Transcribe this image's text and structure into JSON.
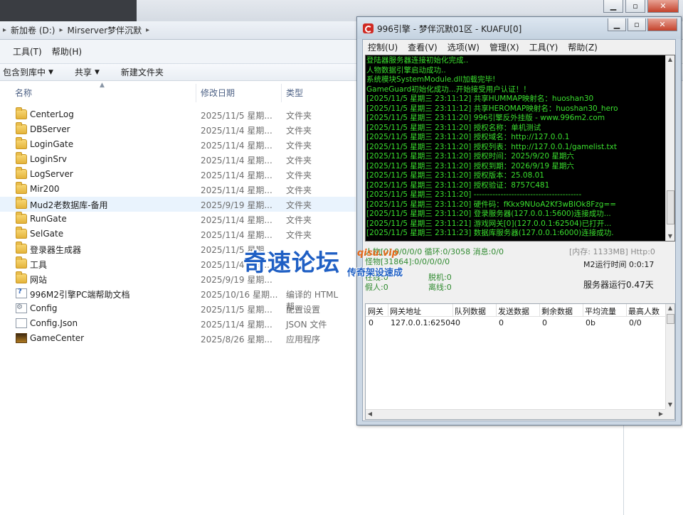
{
  "explorer": {
    "breadcrumb": [
      "新加卷 (D:)",
      "Mirserver梦伴沉默"
    ],
    "menu": [
      "工具(T)",
      "帮助(H)"
    ],
    "toolbar": [
      "包含到库中",
      "共享",
      "新建文件夹"
    ],
    "columns": [
      "名称",
      "修改日期",
      "类型"
    ],
    "files": [
      {
        "name": "CenterLog",
        "date": "2025/11/5 星期...",
        "type": "文件夹",
        "icon": "folder-icon"
      },
      {
        "name": "DBServer",
        "date": "2025/11/4 星期...",
        "type": "文件夹",
        "icon": "folder-icon"
      },
      {
        "name": "LoginGate",
        "date": "2025/11/4 星期...",
        "type": "文件夹",
        "icon": "folder-icon"
      },
      {
        "name": "LoginSrv",
        "date": "2025/11/4 星期...",
        "type": "文件夹",
        "icon": "folder-icon"
      },
      {
        "name": "LogServer",
        "date": "2025/11/4 星期...",
        "type": "文件夹",
        "icon": "folder-icon"
      },
      {
        "name": "Mir200",
        "date": "2025/11/4 星期...",
        "type": "文件夹",
        "icon": "folder-icon"
      },
      {
        "name": "Mud2老数据库-备用",
        "date": "2025/9/19 星期...",
        "type": "文件夹",
        "icon": "folder-icon"
      },
      {
        "name": "RunGate",
        "date": "2025/11/4 星期...",
        "type": "文件夹",
        "icon": "folder-icon"
      },
      {
        "name": "SelGate",
        "date": "2025/11/4 星期...",
        "type": "文件夹",
        "icon": "folder-icon"
      },
      {
        "name": "登录器生成器",
        "date": "2025/11/5 星期...",
        "type": "",
        "icon": "folder-icon"
      },
      {
        "name": "工具",
        "date": "2025/11/4 星期...",
        "type": "",
        "icon": "folder-icon"
      },
      {
        "name": "网站",
        "date": "2025/9/19 星期...",
        "type": "",
        "icon": "folder-icon"
      },
      {
        "name": "996M2引擎PC端帮助文档",
        "date": "2025/10/16 星期...",
        "type": "编译的 HTML 帮...",
        "icon": "help-file-icon"
      },
      {
        "name": "Config",
        "date": "2025/11/5 星期...",
        "type": "配置设置",
        "icon": "config-file-icon"
      },
      {
        "name": "Config.Json",
        "date": "2025/11/4 星期...",
        "type": "JSON 文件",
        "icon": "document-icon"
      },
      {
        "name": "GameCenter",
        "date": "2025/8/26 星期...",
        "type": "应用程序",
        "icon": "app-icon"
      }
    ]
  },
  "kuafu": {
    "title": "996引擎 - 梦伴沉默01区 - KUAFU[0]",
    "menu": [
      "控制(U)",
      "查看(V)",
      "选项(W)",
      "管理(X)",
      "工具(Y)",
      "帮助(Z)"
    ],
    "log": [
      "登陆器服务器连接初始化完成..",
      "人物数据引擎启动成功..",
      "系统模块SystemModule.dll加载完毕!",
      "GameGuard初始化成功...开始接受用户认证！！",
      "[2025/11/5 星期三 23:11:12] 共享HUMMAP映射名：huoshan30",
      "[2025/11/5 星期三 23:11:12] 共享HEROMAP映射名：huoshan30_hero",
      "[2025/11/5 星期三 23:11:20] 996引擎反外挂版 - www.996m2.com",
      "[2025/11/5 星期三 23:11:20] 授权名称：单机测试",
      "[2025/11/5 星期三 23:11:20] 授权域名：http://127.0.0.1",
      "[2025/11/5 星期三 23:11:20] 授权列表：http://127.0.0.1/gamelist.txt",
      "[2025/11/5 星期三 23:11:20] 授权时间：2025/9/20 星期六",
      "[2025/11/5 星期三 23:11:20] 授权到期：2026/9/19 星期六",
      "[2025/11/5 星期三 23:11:20] 授权版本：25.08.01",
      "[2025/11/5 星期三 23:11:20] 授权验证：8757C481",
      "[2025/11/5 星期三 23:11:20] ----------------------------------------",
      "[2025/11/5 星期三 23:11:20] 硬件码：fKkx9NUoA2Kf3wBIOk8Fzg==",
      "[2025/11/5 星期三 23:11:20] 登录服务器(127.0.0.1:5600)连接成功...",
      "[2025/11/5 星期三 23:11:21] 游戏网关[0](127.0.0.1:62504)已打开...",
      "[2025/11/5 星期三 23:11:23] 数据库服务器(127.0.0.1:6000)连接成功."
    ],
    "status": {
      "line1_left": "人物[0] 0/0/0/0 循环:0/3058  消息:0/0",
      "line1_right": "[内存: 1133MB] Http:0",
      "line2_left": "怪物[31864]:0/0/0/0/0",
      "m2_runtime": "M2运行时间 0:0:17",
      "online": "在线:0",
      "offline_bot": "脱机:0",
      "fake": "假人:0",
      "disconnected": "离线:0",
      "server_uptime": "服务器运行0.47天"
    },
    "table": {
      "headers": [
        "网关",
        "网关地址",
        "队列数据",
        "发送数据",
        "剩余数据",
        "平均流量",
        "最高人数"
      ],
      "rows": [
        [
          "0",
          "127.0.0.1:62504",
          "0",
          "0",
          "0",
          "0b",
          "0/0"
        ]
      ]
    }
  },
  "watermark": {
    "main": "奇速论坛",
    "url": "qisu.vip",
    "sub": "传奇架设速成"
  },
  "colors": {
    "log_background": "#000000",
    "log_text": "#3adf2e",
    "status_green": "#2f8a2f",
    "watermark_blue": "#1f5fc4",
    "watermark_orange": "#e56a1c"
  }
}
